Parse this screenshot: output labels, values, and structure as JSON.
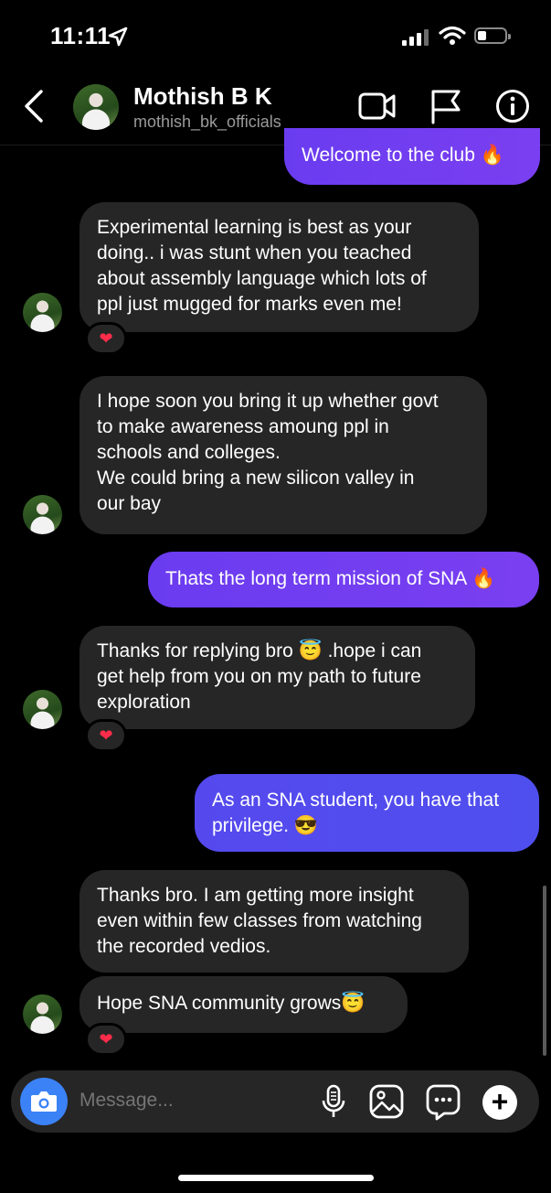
{
  "status_bar": {
    "time": "11:11"
  },
  "header": {
    "name": "Mothish B K",
    "username": "mothish_bk_officials"
  },
  "messages": [
    {
      "text": "Welcome to the club 🔥"
    },
    {
      "text": "Experimental learning is best as your\ndoing.. i was stunt when you teached\nabout assembly language which  lots of\nppl just mugged for marks even me!",
      "reaction": "❤"
    },
    {
      "text": "I hope soon you bring it up whether govt\nto make awareness amoung ppl in\nschools and colleges.\nWe could bring a new silicon valley in\nour bay"
    },
    {
      "text": "Thats the long term mission of SNA 🔥"
    },
    {
      "text": "Thanks for  replying bro 😇 .hope i can\nget help from you on my path to future\nexploration",
      "reaction": "❤"
    },
    {
      "text": "As an SNA student, you have that\nprivilege. 😎"
    },
    {
      "text": "Thanks  bro. I am getting more insight\neven within few classes from watching\nthe recorded vedios."
    },
    {
      "text": "Hope SNA  community grows😇",
      "reaction": "❤"
    }
  ],
  "composer": {
    "placeholder": "Message..."
  },
  "colors": {
    "outgoing_purple": "#7a3ff0",
    "outgoing_blue": "#5050ee",
    "incoming": "#262626",
    "camera_button": "#3b82f6"
  }
}
